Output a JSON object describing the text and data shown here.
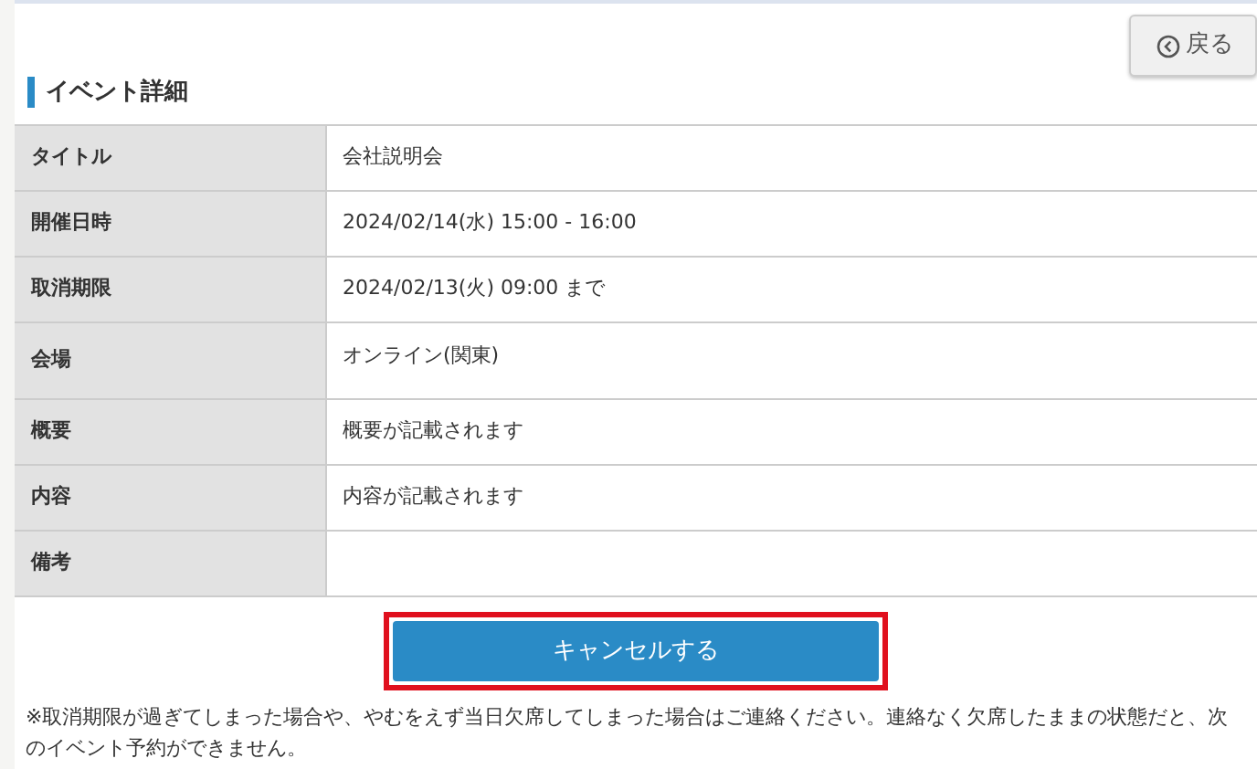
{
  "back_button": {
    "label": "戻る"
  },
  "heading": "イベント詳細",
  "details": [
    {
      "label": "タイトル",
      "value": "会社説明会"
    },
    {
      "label": "開催日時",
      "value": "2024/02/14(水) 15:00 - 16:00"
    },
    {
      "label": "取消期限",
      "value": "2024/02/13(火) 09:00 まで"
    },
    {
      "label": "会場",
      "value": "オンライン(関東)",
      "kind": "tall"
    },
    {
      "label": "概要",
      "value": "概要が記載されます"
    },
    {
      "label": "内容",
      "value": "内容が記載されます"
    },
    {
      "label": "備考"
    }
  ],
  "cancel_button": {
    "label": "キャンセルする",
    "highlighted": true
  },
  "note": "※取消期限が過ぎてしまった場合や、やむをえず当日欠席してしまった場合はご連絡ください。連絡なく欠席したままの状態だと、次のイベント予約ができません。"
}
